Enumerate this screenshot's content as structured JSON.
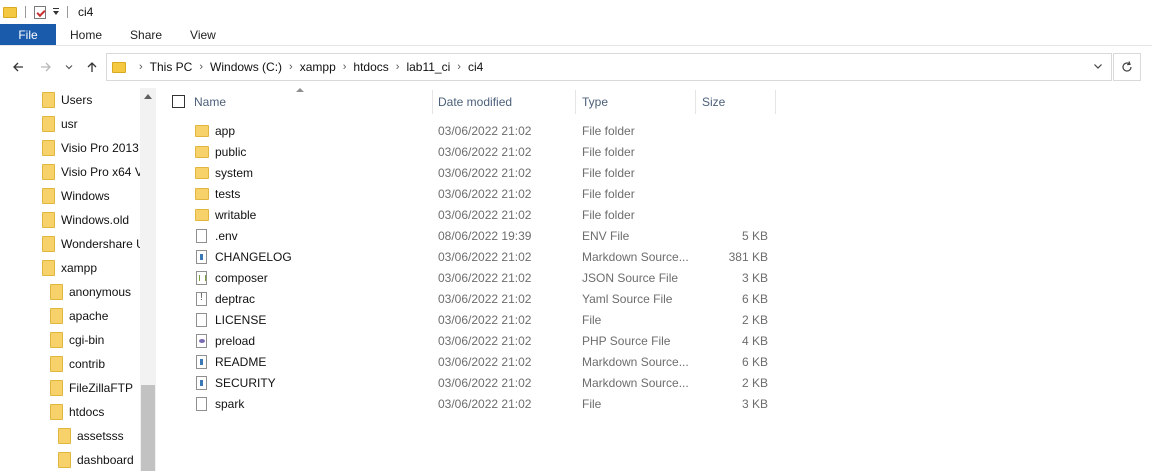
{
  "window": {
    "title": "ci4"
  },
  "ribbon": {
    "tabs": [
      "File",
      "Home",
      "Share",
      "View"
    ]
  },
  "nav": {
    "back_icon": "arrow-left-icon",
    "forward_icon": "arrow-right-icon",
    "recent_icon": "chevron-down-icon",
    "up_icon": "arrow-up-icon"
  },
  "address": {
    "crumbs": [
      "This PC",
      "Windows (C:)",
      "xampp",
      "htdocs",
      "lab11_ci",
      "ci4"
    ]
  },
  "sidebar": {
    "items": [
      {
        "label": "Users"
      },
      {
        "label": "usr"
      },
      {
        "label": "Visio Pro 2013 x"
      },
      {
        "label": "Visio Pro x64 V"
      },
      {
        "label": "Windows"
      },
      {
        "label": "Windows.old"
      },
      {
        "label": "Wondershare U"
      },
      {
        "label": "xampp"
      },
      {
        "label": "anonymous"
      },
      {
        "label": "apache"
      },
      {
        "label": "cgi-bin"
      },
      {
        "label": "contrib"
      },
      {
        "label": "FileZillaFTP"
      },
      {
        "label": "htdocs"
      },
      {
        "label": "assetsss"
      },
      {
        "label": "dashboard"
      }
    ]
  },
  "filelist": {
    "columns": {
      "name": "Name",
      "date": "Date modified",
      "type": "Type",
      "size": "Size"
    },
    "rows": [
      {
        "name": "app",
        "date": "03/06/2022 21:02",
        "type": "File folder",
        "size": "",
        "icon": "folder-icon"
      },
      {
        "name": "public",
        "date": "03/06/2022 21:02",
        "type": "File folder",
        "size": "",
        "icon": "folder-icon"
      },
      {
        "name": "system",
        "date": "03/06/2022 21:02",
        "type": "File folder",
        "size": "",
        "icon": "folder-icon"
      },
      {
        "name": "tests",
        "date": "03/06/2022 21:02",
        "type": "File folder",
        "size": "",
        "icon": "folder-icon"
      },
      {
        "name": "writable",
        "date": "03/06/2022 21:02",
        "type": "File folder",
        "size": "",
        "icon": "folder-icon"
      },
      {
        "name": ".env",
        "date": "08/06/2022 19:39",
        "type": "ENV File",
        "size": "5 KB",
        "icon": "file-icon"
      },
      {
        "name": "CHANGELOG",
        "date": "03/06/2022 21:02",
        "type": "Markdown Source...",
        "size": "381 KB",
        "icon": "markdown-file-icon"
      },
      {
        "name": "composer",
        "date": "03/06/2022 21:02",
        "type": "JSON Source File",
        "size": "3 KB",
        "icon": "json-file-icon"
      },
      {
        "name": "deptrac",
        "date": "03/06/2022 21:02",
        "type": "Yaml Source File",
        "size": "6 KB",
        "icon": "yaml-file-icon"
      },
      {
        "name": "LICENSE",
        "date": "03/06/2022 21:02",
        "type": "File",
        "size": "2 KB",
        "icon": "file-icon"
      },
      {
        "name": "preload",
        "date": "03/06/2022 21:02",
        "type": "PHP Source File",
        "size": "4 KB",
        "icon": "php-file-icon"
      },
      {
        "name": "README",
        "date": "03/06/2022 21:02",
        "type": "Markdown Source...",
        "size": "6 KB",
        "icon": "markdown-file-icon"
      },
      {
        "name": "SECURITY",
        "date": "03/06/2022 21:02",
        "type": "Markdown Source...",
        "size": "2 KB",
        "icon": "markdown-file-icon"
      },
      {
        "name": "spark",
        "date": "03/06/2022 21:02",
        "type": "File",
        "size": "3 KB",
        "icon": "file-icon"
      }
    ]
  }
}
